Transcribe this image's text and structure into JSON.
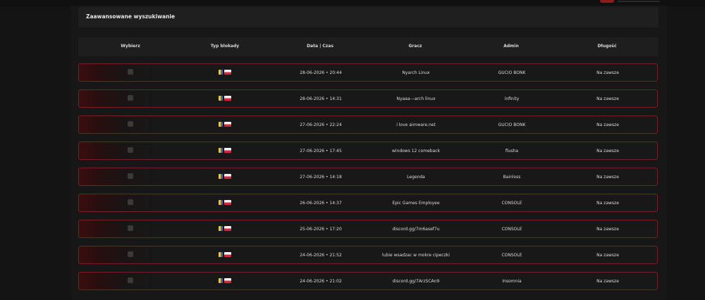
{
  "search": {
    "title": "Zaawansowane wyszukiwanie"
  },
  "table": {
    "headers": [
      "Wybierz",
      "Typ blokady",
      "Data | Czas",
      "Gracz",
      "Admin",
      "Długość"
    ],
    "rows": [
      {
        "datetime": "28-06-2026 • 20:44",
        "player": "Nyarch Linux",
        "admin": "GUCIO BONK",
        "duration": "Na zawsze"
      },
      {
        "datetime": "28-06-2026 • 14:31",
        "player": "Nyaaa---arch linux",
        "admin": "infinity",
        "duration": "Na zawsze"
      },
      {
        "datetime": "27-06-2026 • 22:24",
        "player": "i love aimware.net",
        "admin": "GUCIO BONK",
        "duration": "Na zawsze"
      },
      {
        "datetime": "27-06-2026 • 17:45",
        "player": "windows 12 comeback",
        "admin": "flusha",
        "duration": "Na zawsze"
      },
      {
        "datetime": "27-06-2026 • 14:18",
        "player": "Legenda",
        "admin": "Bainloss",
        "duration": "Na zawsze"
      },
      {
        "datetime": "26-06-2026 • 14:37",
        "player": "Epic Games Employee",
        "admin": "CONSOLE",
        "duration": "Na zawsze"
      },
      {
        "datetime": "25-06-2026 • 17:20",
        "player": "discord.gg/7m6asef7u",
        "admin": "CONSOLE",
        "duration": "Na zawsze"
      },
      {
        "datetime": "24-06-2026 • 21:52",
        "player": "lubie wsadzac w mokre cipeczki",
        "admin": "CONSOLE",
        "duration": "Na zawsze"
      },
      {
        "datetime": "24-06-2026 • 21:02",
        "player": "discord.gg/7ArzSCAn9",
        "admin": "Insomnia",
        "duration": "Na zawsze"
      }
    ]
  },
  "icons": {
    "ban_type": "ban-type-icon",
    "country_flag": "poland-flag-icon"
  },
  "colors": {
    "accent": "#8c1c1c",
    "row_border": "#7a1f1f",
    "background": "#141414"
  }
}
